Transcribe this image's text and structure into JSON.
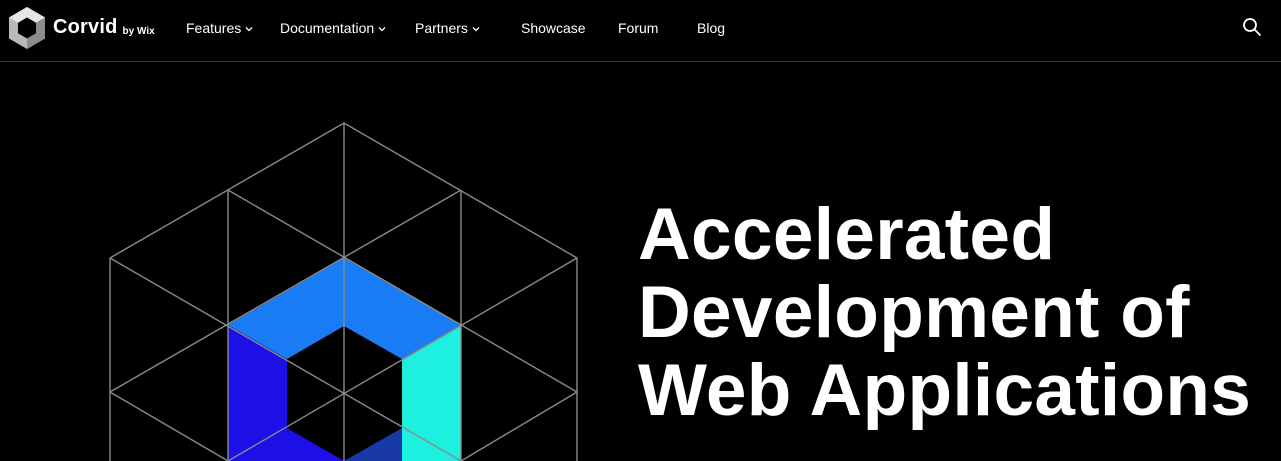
{
  "brand": {
    "name": "Corvid",
    "byline": "by Wix"
  },
  "nav": {
    "items": [
      {
        "label": "Features",
        "has_dropdown": true
      },
      {
        "label": "Documentation",
        "has_dropdown": true
      },
      {
        "label": "Partners",
        "has_dropdown": true
      },
      {
        "label": "Showcase",
        "has_dropdown": false
      },
      {
        "label": "Forum",
        "has_dropdown": false
      },
      {
        "label": "Blog",
        "has_dropdown": false
      }
    ],
    "search_icon": "search-icon"
  },
  "hero": {
    "title_lines": [
      "Accelerated",
      "Development of",
      "Web Applications"
    ]
  },
  "colors": {
    "background": "#000000",
    "text": "#ffffff",
    "nav_border": "#3a3a3a",
    "grid_lines": "#8a8a8a",
    "face_top": "#1a7cf5",
    "face_right": "#1ef0e0",
    "face_left": "#1d10e6",
    "face_bottom": "#183aa8"
  }
}
